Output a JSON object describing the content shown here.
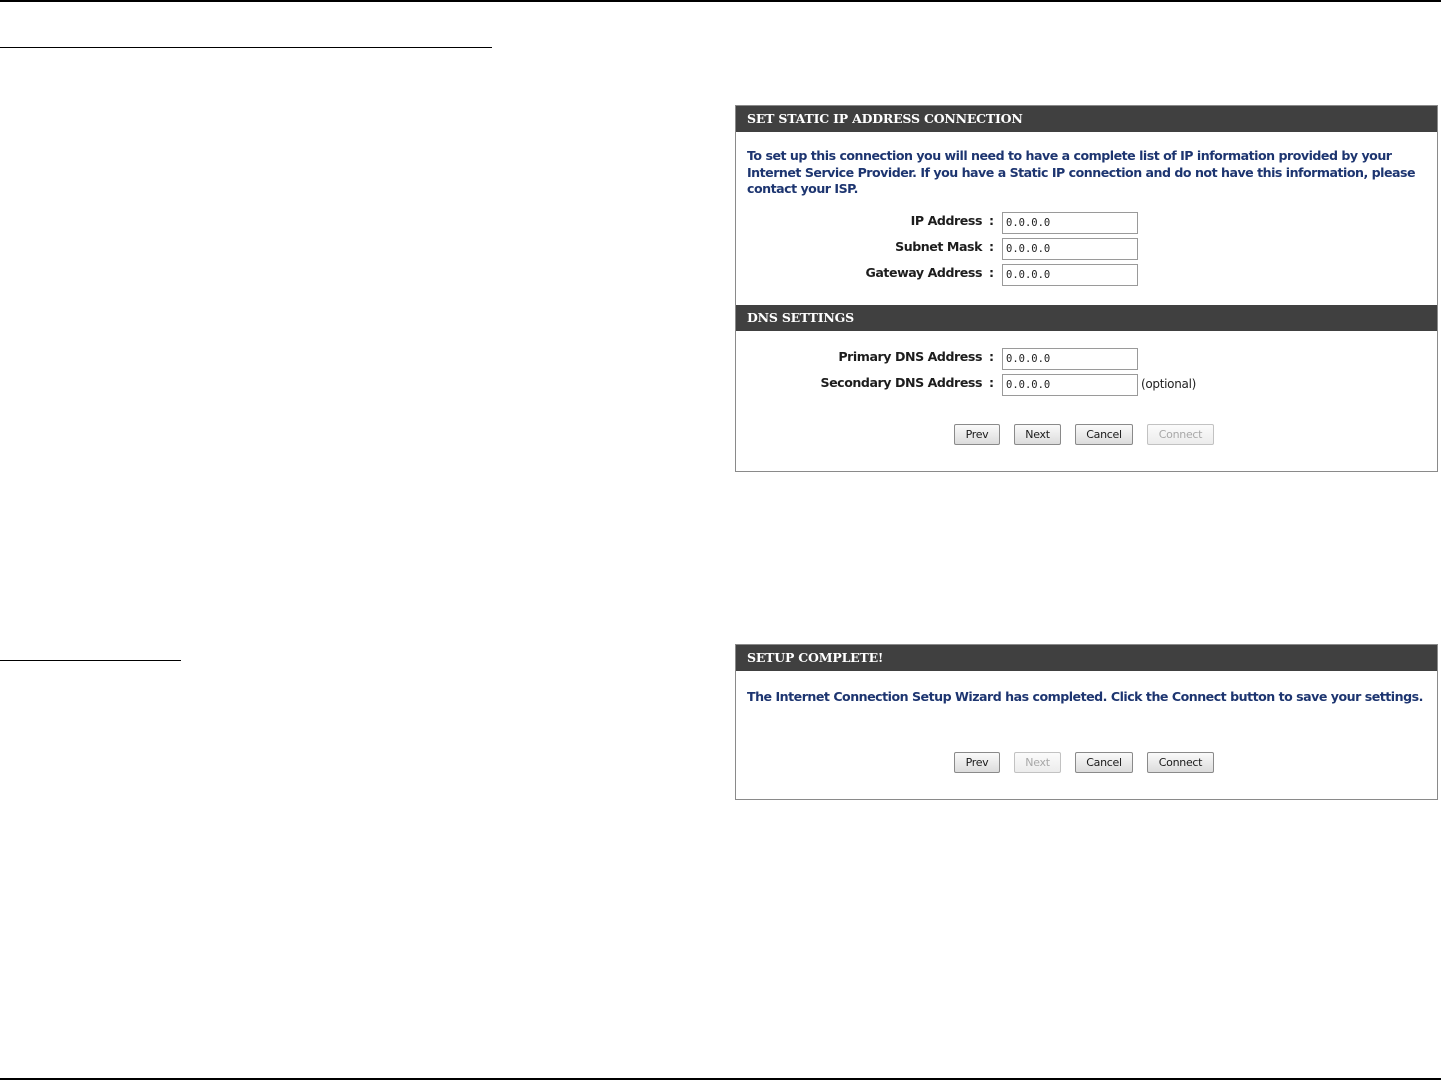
{
  "static_ip_panel": {
    "header": "SET STATIC IP ADDRESS CONNECTION",
    "intro": "To set up this connection you will need to have a complete list of IP information provided by your Internet Service Provider. If you have a Static IP connection and do not have this information, please contact your ISP.",
    "fields": [
      {
        "label": "IP Address",
        "value": "0.0.0.0"
      },
      {
        "label": "Subnet Mask",
        "value": "0.0.0.0"
      },
      {
        "label": "Gateway Address",
        "value": "0.0.0.0"
      }
    ],
    "colon": ":"
  },
  "dns_settings": {
    "header": "DNS SETTINGS",
    "fields": [
      {
        "label": "Primary DNS Address",
        "value": "0.0.0.0"
      },
      {
        "label": "Secondary DNS Address",
        "value": "0.0.0.0",
        "hint": "(optional)"
      }
    ],
    "buttons": {
      "prev": "Prev",
      "next": "Next",
      "cancel": "Cancel",
      "connect": "Connect",
      "connect_enabled": false
    }
  },
  "setup_complete_panel": {
    "header": "SETUP COMPLETE!",
    "message": "The Internet Connection Setup Wizard has completed. Click the Connect button to save your settings.",
    "buttons": {
      "prev": "Prev",
      "next": "Next",
      "next_enabled": false,
      "cancel": "Cancel",
      "connect": "Connect"
    }
  },
  "colors": {
    "header_bg": "#404040",
    "header_text": "#ffffff",
    "body_text": "#1d3570",
    "border": "#8a8a8a"
  }
}
